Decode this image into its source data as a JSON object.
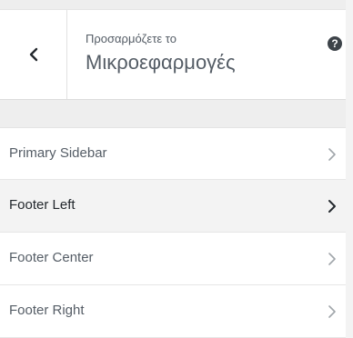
{
  "header": {
    "subtitle": "Προσαρμόζετε το",
    "title": "Μικροεφαρμογές",
    "back_icon": "chevron-left-icon",
    "help_label": "?"
  },
  "menu": {
    "items": [
      {
        "label": "Primary Sidebar",
        "active": false
      },
      {
        "label": "Footer Left",
        "active": true
      },
      {
        "label": "Footer Center",
        "active": false
      },
      {
        "label": "Footer Right",
        "active": false
      }
    ]
  },
  "colors": {
    "text": "#555d66",
    "text_active": "#23282d",
    "chevron": "#a0a5aa",
    "chevron_active": "#23282d"
  }
}
